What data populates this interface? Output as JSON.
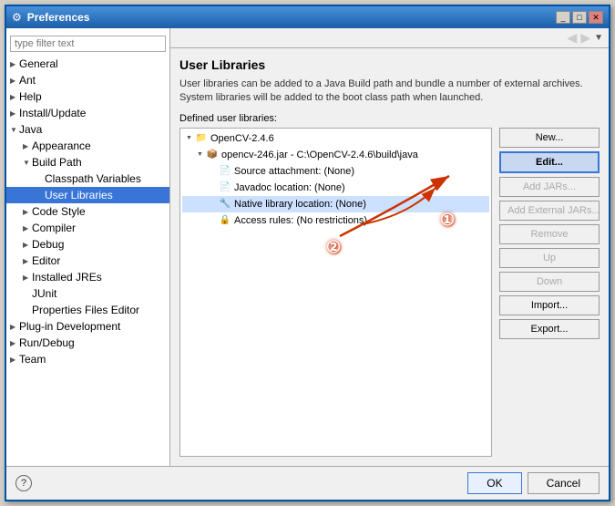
{
  "window": {
    "title": "Preferences",
    "icon": "⚙"
  },
  "title_buttons": {
    "minimize": "_",
    "maximize": "□",
    "close": "✕"
  },
  "sidebar": {
    "filter_placeholder": "type filter text",
    "items": [
      {
        "label": "General",
        "indent": 0,
        "type": "collapsed"
      },
      {
        "label": "Ant",
        "indent": 0,
        "type": "collapsed"
      },
      {
        "label": "Help",
        "indent": 0,
        "type": "collapsed"
      },
      {
        "label": "Install/Update",
        "indent": 0,
        "type": "collapsed"
      },
      {
        "label": "Java",
        "indent": 0,
        "type": "expanded"
      },
      {
        "label": "Appearance",
        "indent": 1,
        "type": "collapsed"
      },
      {
        "label": "Build Path",
        "indent": 1,
        "type": "expanded"
      },
      {
        "label": "Classpath Variables",
        "indent": 2,
        "type": "none"
      },
      {
        "label": "User Libraries",
        "indent": 2,
        "type": "none",
        "selected": true
      },
      {
        "label": "Code Style",
        "indent": 1,
        "type": "collapsed"
      },
      {
        "label": "Compiler",
        "indent": 1,
        "type": "collapsed"
      },
      {
        "label": "Debug",
        "indent": 1,
        "type": "collapsed"
      },
      {
        "label": "Editor",
        "indent": 1,
        "type": "collapsed"
      },
      {
        "label": "Installed JREs",
        "indent": 1,
        "type": "collapsed"
      },
      {
        "label": "JUnit",
        "indent": 1,
        "type": "none"
      },
      {
        "label": "Properties Files Editor",
        "indent": 1,
        "type": "none"
      },
      {
        "label": "Plug-in Development",
        "indent": 0,
        "type": "collapsed"
      },
      {
        "label": "Run/Debug",
        "indent": 0,
        "type": "collapsed"
      },
      {
        "label": "Team",
        "indent": 0,
        "type": "collapsed"
      }
    ]
  },
  "main": {
    "title": "User Libraries",
    "description": "User libraries can be added to a Java Build path and bundle a number of external archives. System libraries will be added to the boot class path when launched.",
    "defined_label": "Defined user libraries:",
    "libraries": [
      {
        "label": "OpenCV-2.4.6",
        "type": "root",
        "expanded": true,
        "children": [
          {
            "label": "opencv-246.jar - C:\\OpenCV-2.4.6\\build\\java",
            "type": "jar",
            "expanded": true,
            "children": [
              {
                "label": "Source attachment: (None)",
                "type": "item"
              },
              {
                "label": "Javadoc location: (None)",
                "type": "item"
              },
              {
                "label": "Native library location: (None)",
                "type": "item"
              },
              {
                "label": "Access rules: (No restrictions)",
                "type": "item"
              }
            ]
          }
        ]
      }
    ]
  },
  "buttons": {
    "new": "New...",
    "edit": "Edit...",
    "add_jars": "Add JARs...",
    "add_external_jars": "Add External JARs...",
    "remove": "Remove",
    "up": "Up",
    "down": "Down",
    "import": "Import...",
    "export": "Export..."
  },
  "bottom": {
    "ok": "OK",
    "cancel": "Cancel"
  },
  "annotations": {
    "circle1": "①",
    "circle2": "②"
  }
}
